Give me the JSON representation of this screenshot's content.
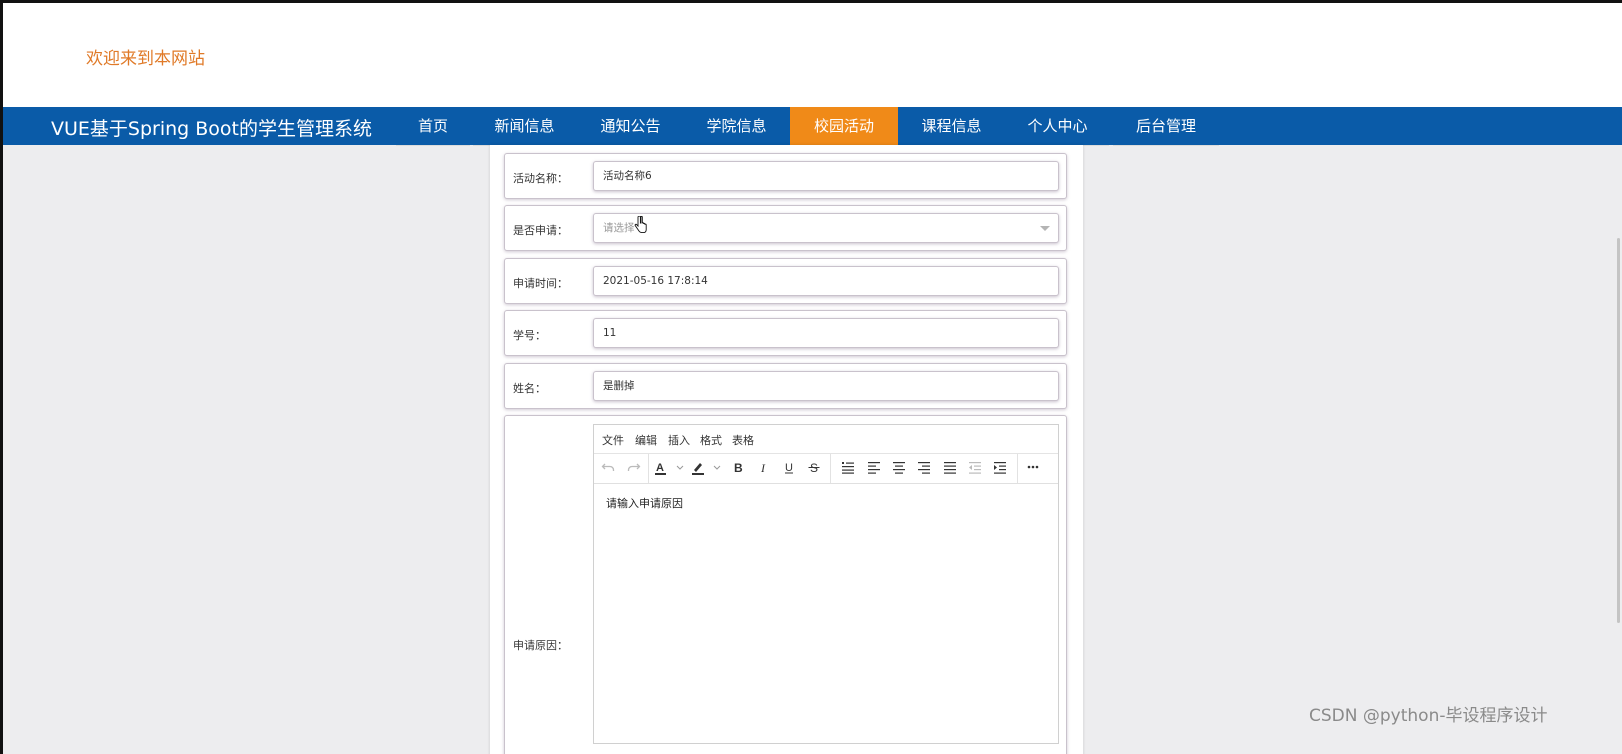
{
  "header": {
    "welcome_text": "欢迎来到本网站",
    "welcome_color": "#e07a28"
  },
  "navbar": {
    "site_title": "VUE基于Spring Boot的学生管理系统",
    "background": "#0a5ba8",
    "active_color": "#f08a18",
    "items": [
      {
        "label": "首页"
      },
      {
        "label": "新闻信息"
      },
      {
        "label": "通知公告"
      },
      {
        "label": "学院信息"
      },
      {
        "label": "校园活动",
        "active": true
      },
      {
        "label": "课程信息"
      },
      {
        "label": "个人中心"
      },
      {
        "label": "后台管理"
      }
    ]
  },
  "form": {
    "activity_name": {
      "label": "活动名称：",
      "value": "活动名称6"
    },
    "apply_status": {
      "label": "是否申请：",
      "placeholder": "请选择"
    },
    "apply_time": {
      "label": "申请时间：",
      "value": "2021-05-16 17:8:14"
    },
    "student_id": {
      "label": "学号：",
      "value": "11"
    },
    "name": {
      "label": "姓名：",
      "value": "是删掉"
    },
    "apply_reason": {
      "label": "申请原因：",
      "placeholder": "请输入申请原因",
      "menu": [
        "文件",
        "编辑",
        "插入",
        "格式",
        "表格"
      ],
      "toolbar_icons": [
        "undo-icon",
        "redo-icon",
        "text-color-icon",
        "highlight-icon",
        "bold-icon",
        "italic-icon",
        "underline-icon",
        "strikethrough-icon",
        "bulleted-list-icon",
        "align-left-icon",
        "align-center-icon",
        "align-right-icon",
        "align-justify-icon",
        "outdent-icon",
        "indent-icon",
        "more-icon"
      ]
    }
  },
  "watermark": "CSDN @python-毕设程序设计"
}
